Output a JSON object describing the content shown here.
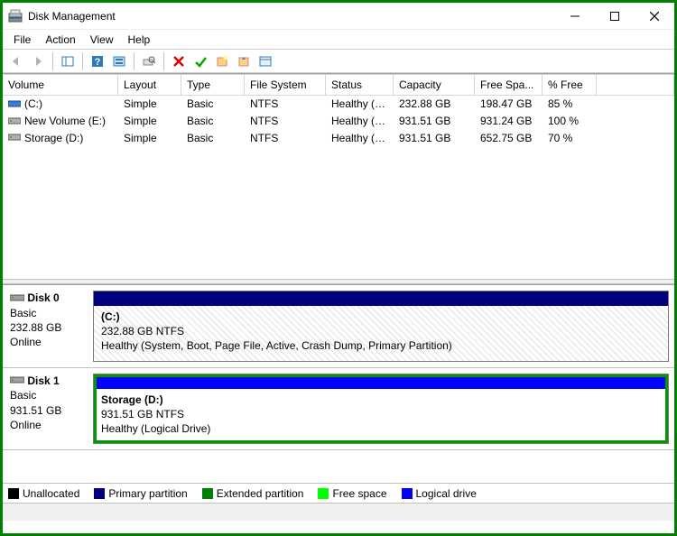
{
  "window": {
    "title": "Disk Management"
  },
  "menu": {
    "file": "File",
    "action": "Action",
    "view": "View",
    "help": "Help"
  },
  "columns": {
    "volume": "Volume",
    "layout": "Layout",
    "type": "Type",
    "fs": "File System",
    "status": "Status",
    "capacity": "Capacity",
    "free": "Free Spa...",
    "pct": "% Free"
  },
  "volumes": [
    {
      "name": "(C:)",
      "icon": "blue",
      "layout": "Simple",
      "type": "Basic",
      "fs": "NTFS",
      "status": "Healthy (S...",
      "capacity": "232.88 GB",
      "free": "198.47 GB",
      "pct": "85 %"
    },
    {
      "name": "New Volume (E:)",
      "icon": "hdd",
      "layout": "Simple",
      "type": "Basic",
      "fs": "NTFS",
      "status": "Healthy (L...",
      "capacity": "931.51 GB",
      "free": "931.24 GB",
      "pct": "100 %"
    },
    {
      "name": "Storage (D:)",
      "icon": "hdd",
      "layout": "Simple",
      "type": "Basic",
      "fs": "NTFS",
      "status": "Healthy (L...",
      "capacity": "931.51 GB",
      "free": "652.75 GB",
      "pct": "70 %"
    }
  ],
  "disks": [
    {
      "name": "Disk 0",
      "type": "Basic",
      "size": "232.88 GB",
      "state": "Online",
      "header_color": "#000080",
      "body_hatch": true,
      "part_name": "(C:)",
      "part_info": "232.88 GB NTFS",
      "part_status": "Healthy (System, Boot, Page File, Active, Crash Dump, Primary Partition)",
      "green_ext": false
    },
    {
      "name": "Disk 1",
      "type": "Basic",
      "size": "931.51 GB",
      "state": "Online",
      "header_color": "#0000ff",
      "body_hatch": false,
      "part_name": "Storage  (D:)",
      "part_info": "931.51 GB NTFS",
      "part_status": "Healthy (Logical Drive)",
      "green_ext": true
    }
  ],
  "legend": {
    "unallocated": {
      "label": "Unallocated",
      "color": "#000000"
    },
    "primary": {
      "label": "Primary partition",
      "color": "#000080"
    },
    "extended": {
      "label": "Extended partition",
      "color": "#008000"
    },
    "freespace": {
      "label": "Free space",
      "color": "#00ff00"
    },
    "logical": {
      "label": "Logical drive",
      "color": "#0000ff"
    }
  }
}
